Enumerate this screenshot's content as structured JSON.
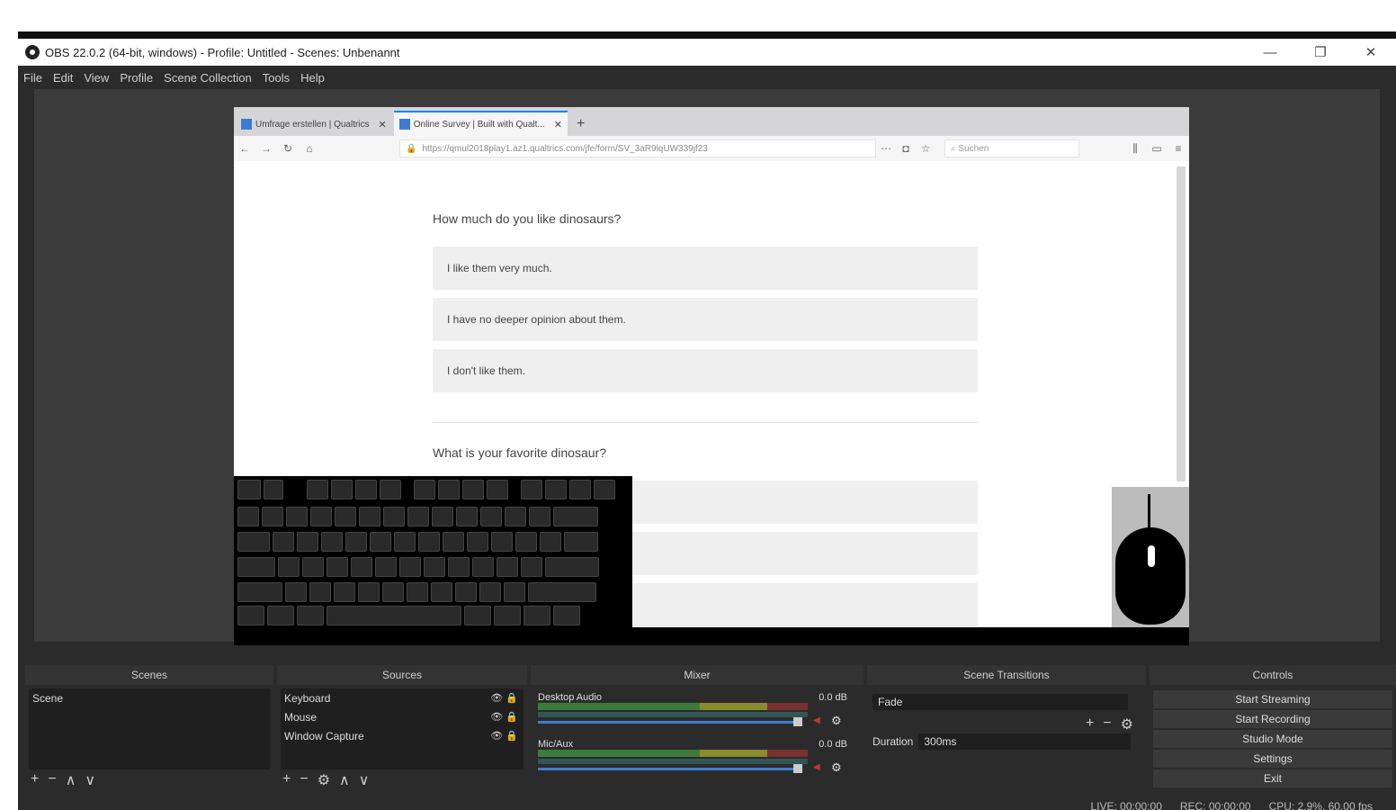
{
  "window": {
    "title": "OBS 22.0.2 (64-bit, windows) - Profile: Untitled - Scenes: Unbenannt",
    "minimize_label": "—",
    "restore_label": "❐",
    "close_label": "✕"
  },
  "menu": [
    "File",
    "Edit",
    "View",
    "Profile",
    "Scene Collection",
    "Tools",
    "Help"
  ],
  "browser": {
    "tabs": [
      {
        "label": "Umfrage erstellen | Qualtrics"
      },
      {
        "label": "Online Survey | Built with Qualt..."
      }
    ],
    "new_tab": "+",
    "url": "https://qmul2018play1.az1.qualtrics.com/jfe/form/SV_3aR9lqUW339jf23",
    "search_placeholder": "Suchen"
  },
  "survey": {
    "question1": "How much do you like dinosaurs?",
    "choices": [
      "I like them very much.",
      "I have no deeper opinion about them.",
      "I don't like them."
    ],
    "question2": "What is your favorite dinosaur?"
  },
  "scenes": {
    "title": "Scenes",
    "items": [
      "Scene"
    ]
  },
  "sources": {
    "title": "Sources",
    "items": [
      "Keyboard",
      "Mouse",
      "Window Capture"
    ]
  },
  "mixer": {
    "title": "Mixer",
    "channels": [
      {
        "name": "Desktop Audio",
        "db": "0.0 dB"
      },
      {
        "name": "Mic/Aux",
        "db": "0.0 dB"
      }
    ]
  },
  "transitions": {
    "title": "Scene Transitions",
    "selected": "Fade",
    "duration_label": "Duration",
    "duration_value": "300ms"
  },
  "controls": {
    "title": "Controls",
    "buttons": [
      "Start Streaming",
      "Start Recording",
      "Studio Mode",
      "Settings",
      "Exit"
    ]
  },
  "status": {
    "live": "LIVE: 00:00:00",
    "rec": "REC: 00:00:00",
    "cpu": "CPU: 2.9%, 60.00 fps"
  }
}
